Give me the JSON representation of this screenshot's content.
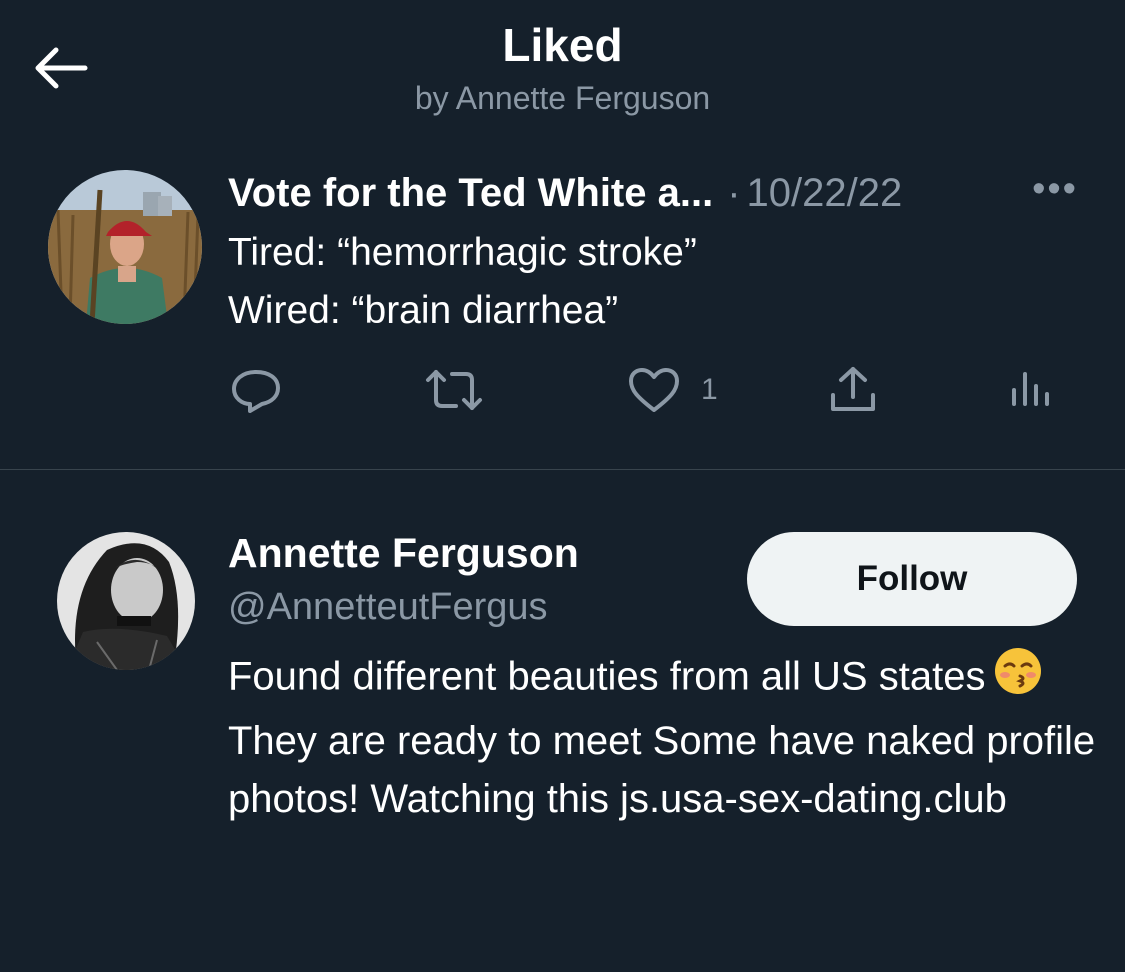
{
  "header": {
    "title": "Liked",
    "subtitle": "by Annette Ferguson"
  },
  "tweet": {
    "author": "Vote for the Ted White a...",
    "separator": "·",
    "date": "10/22/22",
    "more": "•••",
    "lines": [
      "Tired: “hemorrhagic stroke”",
      "Wired: “brain diarrhea”"
    ],
    "like_count": "1",
    "icons": [
      "reply-icon",
      "retweet-icon",
      "like-icon",
      "share-icon",
      "analytics-icon"
    ]
  },
  "user": {
    "name": "Annette Ferguson",
    "handle": "@AnnetteutFergus",
    "follow_label": "Follow",
    "bio_before_emoji": "Found different beauties from all US states",
    "emoji": "😚",
    "bio_after_emoji": "They are ready to meet Some have naked profile photos! Watching this js.usa-sex-dating.club"
  },
  "colors": {
    "background": "#15202b",
    "secondary_text": "#8b98a5",
    "divider": "#38444d",
    "follow_button": "#eff3f4"
  }
}
